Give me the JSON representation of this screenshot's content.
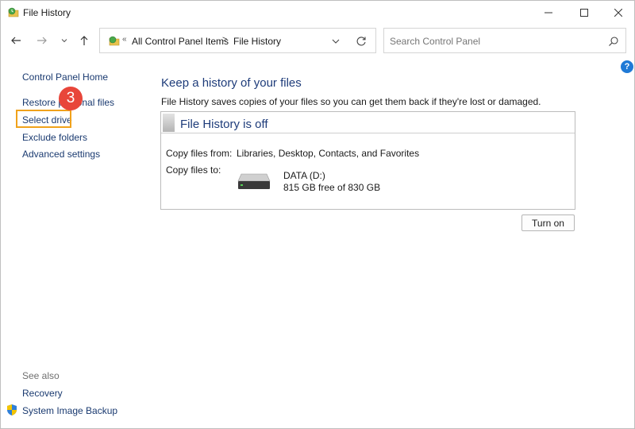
{
  "window": {
    "title": "File History",
    "controls": {
      "minimize": "minimize-icon",
      "maximize": "maximize-icon",
      "close": "close-icon"
    }
  },
  "nav": {
    "back_icon": "arrow-left-icon",
    "forward_icon": "arrow-right-icon",
    "recent_icon": "chevron-down-icon",
    "up_icon": "arrow-up-icon"
  },
  "address": {
    "overflow_chevron": "«",
    "segments": [
      "All Control Panel Items",
      "File History"
    ],
    "separator": ">"
  },
  "search": {
    "placeholder": "Search Control Panel"
  },
  "help": {
    "label": "?"
  },
  "sidebar": {
    "home": "Control Panel Home",
    "items": [
      {
        "label": "Restore personal files"
      },
      {
        "label": "Select drive"
      },
      {
        "label": "Exclude folders"
      },
      {
        "label": "Advanced settings"
      }
    ],
    "see_also_heading": "See also",
    "see_also": [
      {
        "label": "Recovery"
      },
      {
        "label": "System Image Backup"
      }
    ]
  },
  "annotation": {
    "step": "3",
    "highlight_color": "#f0a21b",
    "badge_color": "#e8463a"
  },
  "main": {
    "title": "Keep a history of your files",
    "description": "File History saves copies of your files so you can get them back if they're lost or damaged.",
    "status_title": "File History is off",
    "copy_from_label": "Copy files from:",
    "copy_from_value": "Libraries, Desktop, Contacts, and Favorites",
    "copy_to_label": "Copy files to:",
    "drive": {
      "name": "DATA (D:)",
      "free": "815 GB free of 830 GB"
    },
    "turn_on_label": "Turn on"
  },
  "colors": {
    "heading": "#1e3c7a",
    "link": "#1a3a70",
    "accent": "#1f7ad6"
  }
}
